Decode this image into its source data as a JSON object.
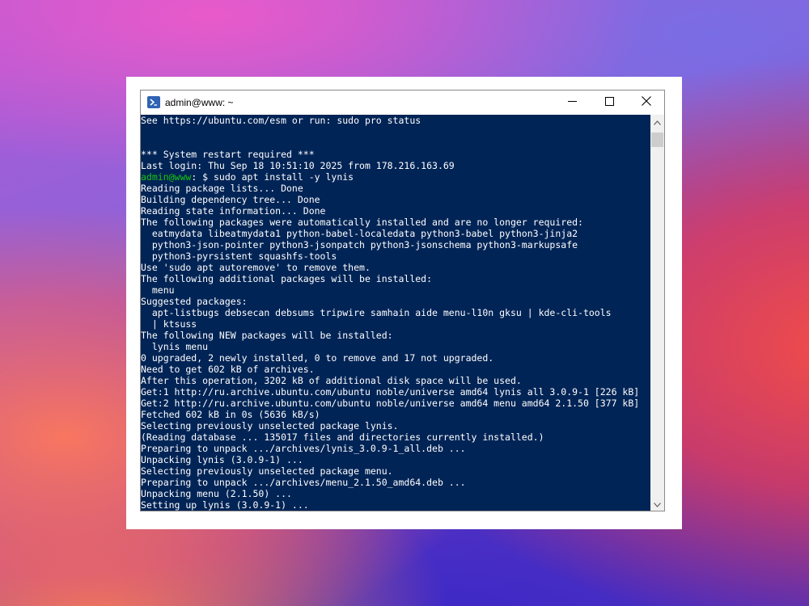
{
  "window": {
    "title": "admin@www: ~",
    "icon": "powershell-icon",
    "controls": [
      "minimize-icon",
      "maximize-icon",
      "close-icon"
    ]
  },
  "terminal": {
    "background": "#012456",
    "prompt_color": "#16c60c",
    "prompt": {
      "user_host": "admin@www",
      "rest": ": $ sudo apt install -y lynis"
    },
    "lines_before_prompt": [
      "See https://ubuntu.com/esm or run: sudo pro status",
      "",
      "",
      "*** System restart required ***",
      "Last login: Thu Sep 18 10:51:10 2025 from 178.216.163.69"
    ],
    "lines_after_prompt": [
      "Reading package lists... Done",
      "Building dependency tree... Done",
      "Reading state information... Done",
      "The following packages were automatically installed and are no longer required:",
      "  eatmydata libeatmydata1 python-babel-localedata python3-babel python3-jinja2",
      "  python3-json-pointer python3-jsonpatch python3-jsonschema python3-markupsafe",
      "  python3-pyrsistent squashfs-tools",
      "Use 'sudo apt autoremove' to remove them.",
      "The following additional packages will be installed:",
      "  menu",
      "Suggested packages:",
      "  apt-listbugs debsecan debsums tripwire samhain aide menu-l10n gksu | kde-cli-tools",
      "  | ktsuss",
      "The following NEW packages will be installed:",
      "  lynis menu",
      "0 upgraded, 2 newly installed, 0 to remove and 17 not upgraded.",
      "Need to get 602 kB of archives.",
      "After this operation, 3202 kB of additional disk space will be used.",
      "Get:1 http://ru.archive.ubuntu.com/ubuntu noble/universe amd64 lynis all 3.0.9-1 [226 kB]",
      "Get:2 http://ru.archive.ubuntu.com/ubuntu noble/universe amd64 menu amd64 2.1.50 [377 kB]",
      "Fetched 602 kB in 0s (5636 kB/s)",
      "Selecting previously unselected package lynis.",
      "(Reading database ... 135017 files and directories currently installed.)",
      "Preparing to unpack .../archives/lynis_3.0.9-1_all.deb ...",
      "Unpacking lynis (3.0.9-1) ...",
      "Selecting previously unselected package menu.",
      "Preparing to unpack .../archives/menu_2.1.50_amd64.deb ...",
      "Unpacking menu (2.1.50) ...",
      "Setting up lynis (3.0.9-1) ..."
    ]
  },
  "scrollbar": {
    "up_icon": "scroll-up-arrow-icon",
    "down_icon": "scroll-down-arrow-icon"
  }
}
